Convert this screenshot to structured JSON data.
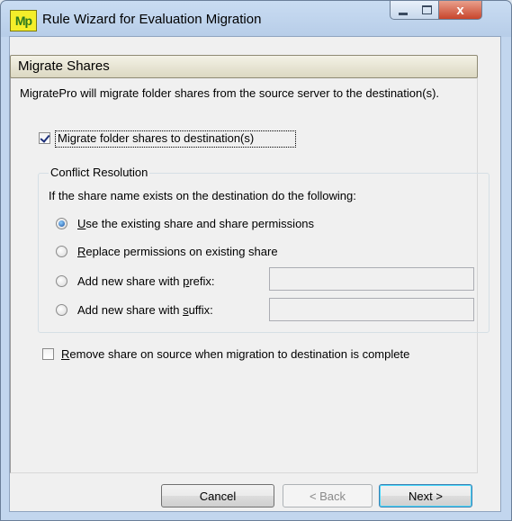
{
  "window": {
    "title": "Rule Wizard for Evaluation Migration",
    "app_icon_text": "Mp",
    "close_glyph": "x"
  },
  "section": {
    "title": "Migrate Shares",
    "description": "MigratePro will migrate folder shares from the source server to the destination(s)."
  },
  "migrate_checkbox": {
    "label": "Migrate folder shares to destination(s)",
    "checked": true
  },
  "conflict": {
    "legend": "Conflict Resolution",
    "instruction": "If the share name exists on the destination do the following:",
    "options": [
      {
        "pre": "",
        "mn": "U",
        "post": "se the existing share and share permissions",
        "selected": true
      },
      {
        "pre": "",
        "mn": "R",
        "post": "eplace permissions on existing share",
        "selected": false
      },
      {
        "pre": "Add new share with ",
        "mn": "p",
        "post": "refix:",
        "selected": false
      },
      {
        "pre": "Add new share with ",
        "mn": "s",
        "post": "uffix:",
        "selected": false
      }
    ],
    "prefix_value": "",
    "suffix_value": ""
  },
  "remove_checkbox": {
    "pre": "",
    "mn": "R",
    "post": "emove share on source when migration to destination is complete",
    "checked": false
  },
  "buttons": {
    "cancel": "Cancel",
    "back": "< Back",
    "next": "Next >"
  },
  "colors": {
    "titlebar": "#b7cde8",
    "close": "#c8452c",
    "header": "#dcd8c2"
  }
}
